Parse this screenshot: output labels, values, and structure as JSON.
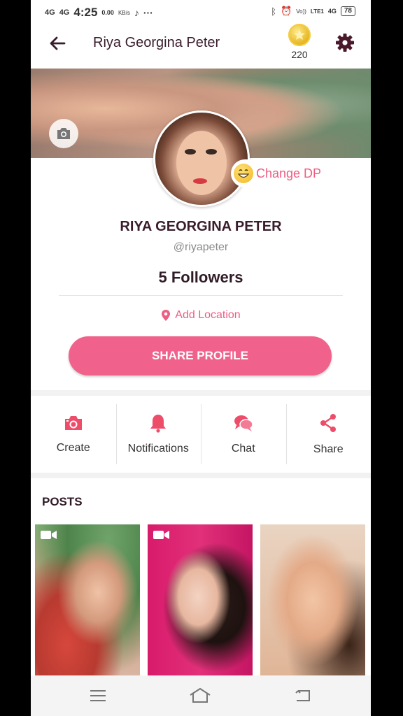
{
  "status_bar": {
    "signal_1": "4G",
    "signal_2": "4G",
    "time": "4:25",
    "speed_value": "0.00",
    "speed_unit": "KB/s",
    "more": "···",
    "volte": "Vo))",
    "lte": "LTE1",
    "net": "4G",
    "battery": "78"
  },
  "header": {
    "title": "Riya Georgina Peter",
    "coins": "220"
  },
  "profile": {
    "change_dp": "Change DP",
    "name": "RIYA GEORGINA PETER",
    "handle": "@riyapeter",
    "followers": "5 Followers",
    "location": "Add Location",
    "share_button": "SHARE PROFILE"
  },
  "actions": [
    {
      "label": "Create",
      "icon": "camera-icon"
    },
    {
      "label": "Notifications",
      "icon": "bell-icon"
    },
    {
      "label": "Chat",
      "icon": "chat-icon"
    },
    {
      "label": "Share",
      "icon": "share-icon"
    }
  ],
  "posts": {
    "title": "POSTS",
    "items": [
      {
        "type": "video"
      },
      {
        "type": "video"
      },
      {
        "type": "photo"
      }
    ]
  },
  "colors": {
    "accent": "#f0628b",
    "accent_text": "#ee5d82",
    "dark_text": "#3a1d2c",
    "gold": "#e2b21a"
  }
}
